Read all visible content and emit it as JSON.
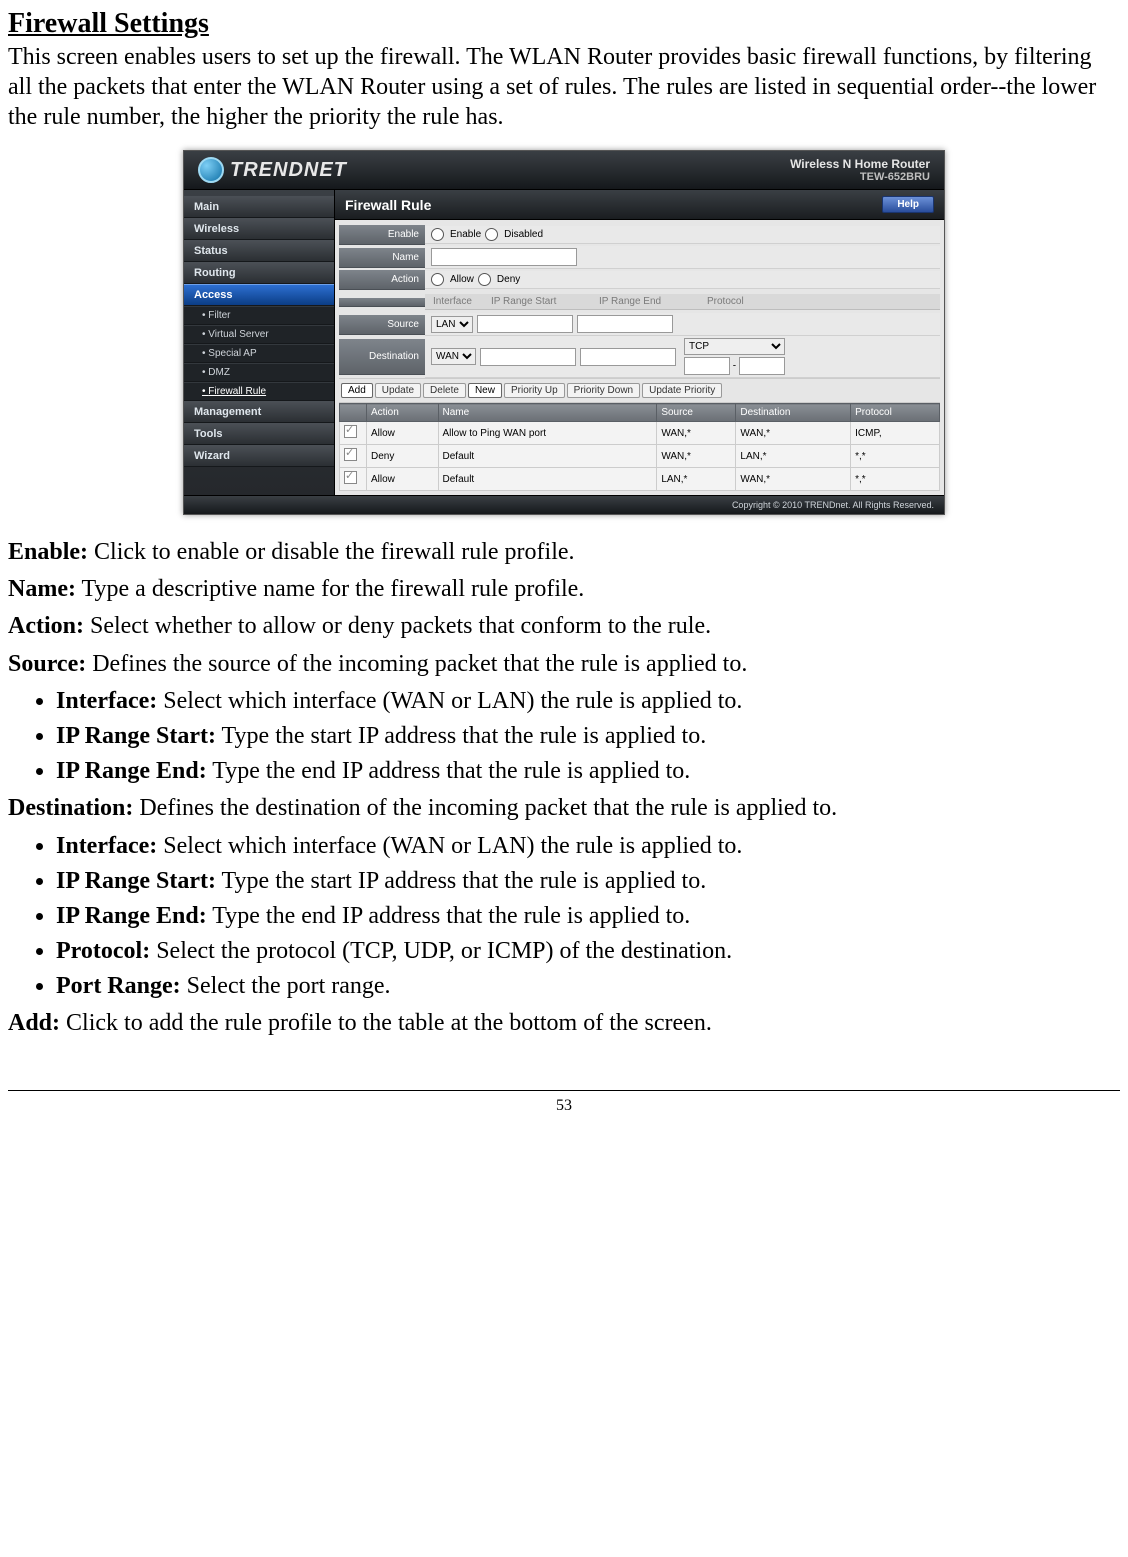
{
  "page": {
    "title": "Firewall Settings",
    "intro": "This screen enables users to set up the firewall. The WLAN Router provides basic firewall functions, by filtering all the packets that enter the WLAN Router using a set of rules. The rules are listed in sequential order--the lower the rule number, the higher the priority the rule has.",
    "page_number": "53"
  },
  "router": {
    "brand": "TRENDNET",
    "model_title": "Wireless N Home Router",
    "model_code": "TEW-652BRU",
    "copyright": "Copyright © 2010 TRENDnet. All Rights Reserved."
  },
  "nav": {
    "items": [
      "Main",
      "Wireless",
      "Status",
      "Routing",
      "Access",
      "Management",
      "Tools",
      "Wizard"
    ],
    "active": "Access",
    "sub_items": [
      "Filter",
      "Virtual Server",
      "Special AP",
      "DMZ",
      "Firewall Rule"
    ],
    "sub_current": "Firewall Rule"
  },
  "panel": {
    "title": "Firewall Rule",
    "help": "Help",
    "form": {
      "enable_label": "Enable",
      "enable_opt1": "Enable",
      "enable_opt2": "Disabled",
      "name_label": "Name",
      "action_label": "Action",
      "action_opt1": "Allow",
      "action_opt2": "Deny",
      "header_interface": "Interface",
      "header_ipstart": "IP Range Start",
      "header_ipend": "IP Range End",
      "header_protocol": "Protocol",
      "source_label": "Source",
      "source_if": "LAN",
      "dest_label": "Destination",
      "dest_if": "WAN",
      "dest_proto": "TCP"
    },
    "buttons": {
      "add": "Add",
      "update": "Update",
      "delete": "Delete",
      "new": "New",
      "pri_up": "Priority Up",
      "pri_down": "Priority Down",
      "upd_pri": "Update Priority"
    },
    "table": {
      "headers": [
        "",
        "Action",
        "Name",
        "Source",
        "Destination",
        "Protocol"
      ],
      "rows": [
        {
          "action": "Allow",
          "name": "Allow to Ping WAN port",
          "source": "WAN,*",
          "dest": "WAN,*",
          "proto": "ICMP,"
        },
        {
          "action": "Deny",
          "name": "Default",
          "source": "WAN,*",
          "dest": "LAN,*",
          "proto": "*,*"
        },
        {
          "action": "Allow",
          "name": "Default",
          "source": "LAN,*",
          "dest": "WAN,*",
          "proto": "*,*"
        }
      ]
    }
  },
  "defs": {
    "enable": {
      "term": "Enable:",
      "text": " Click to enable or disable the firewall rule profile."
    },
    "name": {
      "term": "Name:",
      "text": " Type a descriptive name for the firewall rule profile."
    },
    "action": {
      "term": "Action:",
      "text": " Select whether to allow or deny packets that conform to the rule."
    },
    "source": {
      "term": "Source:",
      "text": " Defines the source of the incoming packet that the rule is applied to."
    },
    "source_items": [
      {
        "term": "Interface:",
        "text": " Select which interface (WAN or LAN) the rule is applied to."
      },
      {
        "term": "IP Range Start:",
        "text": " Type the start IP address that the rule is applied to."
      },
      {
        "term": "IP Range End:",
        "text": " Type the end IP address that the rule is applied to."
      }
    ],
    "destination": {
      "term": "Destination:",
      "text": " Defines the destination of the incoming packet that the rule is applied to."
    },
    "dest_items": [
      {
        "term": "Interface:",
        "text": " Select which interface (WAN or LAN) the rule is applied to."
      },
      {
        "term": "IP Range Start:",
        "text": " Type the start IP address that the rule is applied to."
      },
      {
        "term": "IP Range End:",
        "text": " Type the end IP address that the rule is applied to."
      },
      {
        "term": "Protocol:",
        "text": " Select the protocol (TCP, UDP, or ICMP) of the destination."
      },
      {
        "term": "Port Range:",
        "text": " Select the port range."
      }
    ],
    "add": {
      "term": "Add:",
      "text": " Click to add the rule profile to the table at the bottom of the screen."
    }
  }
}
